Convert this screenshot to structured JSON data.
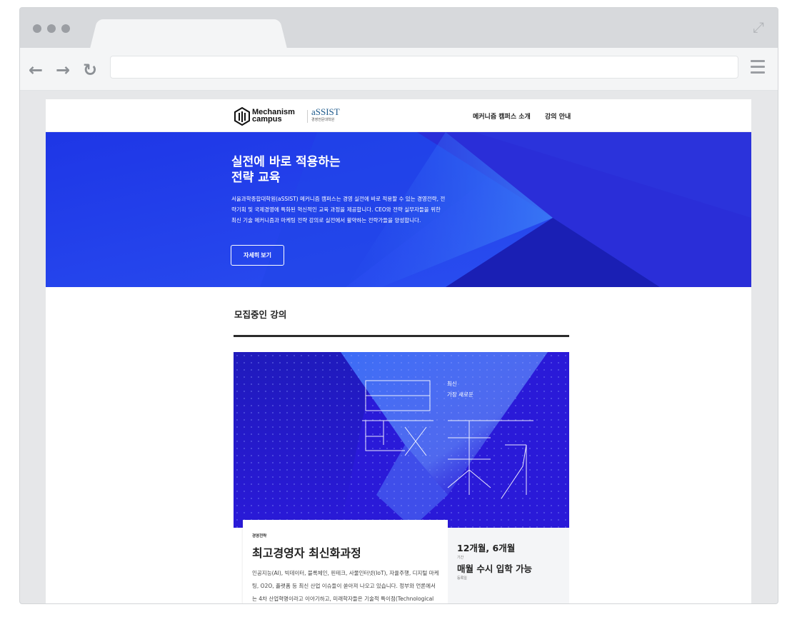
{
  "site": {
    "logo_line1": "Mechanism",
    "logo_line2": "campus",
    "partner_logo": "aSSIST",
    "partner_sub": "경영전문대학원",
    "nav": [
      "메커니즘 캠퍼스 소개",
      "강의 안내"
    ]
  },
  "hero": {
    "title_line1": "실전에 바로 적용하는",
    "title_line2": "전략 교육",
    "description": "서울과학종합대학원(aSSIST) 메커니즘 캠퍼스는 경영 실전에 바로 적용할 수 있는 경영전략, 전략기획 및 국제경영에 특화된 혁신적인 교육 과정을 제공합니다. CEO와 전략 실무자들을 위한 최신 기술 메커니즘과 마케팅 전략 강의로 실전에서 활약하는 전략가들을 양성합니다.",
    "button": "자세히 보기"
  },
  "section": {
    "title": "모집중인 강의"
  },
  "course": {
    "image_tag_1": "최신",
    "image_tag_2": "가장 새로운",
    "category": "경영전략",
    "title": "최고경영자 최신화과정",
    "description": "인공지능(AI), 빅데이터, 블록체인, 핀테크, 사물인터넷(IoT), 자율주행, 디지털 마케팅, O2O, 플랫폼 등 최신 산업 이슈들이 쏟아져 나오고 있습니다. 정부와 언론에서는 4차 산업혁명이라고 이야기하고, 미래학자들은 기술적 특이점(Technological Singularity)이 다가오고",
    "duration_value": "12개월, 6개월",
    "duration_label": "기간",
    "enroll_value": "매월 수시 입학 가능",
    "enroll_label": "등록일"
  },
  "colors": {
    "hero_blue": "#1b3fe0",
    "card_purple": "#2a1ad8"
  },
  "icons": {
    "back": "arrow-left",
    "forward": "arrow-right",
    "reload": "reload",
    "menu": "hamburger",
    "expand": "expand"
  }
}
